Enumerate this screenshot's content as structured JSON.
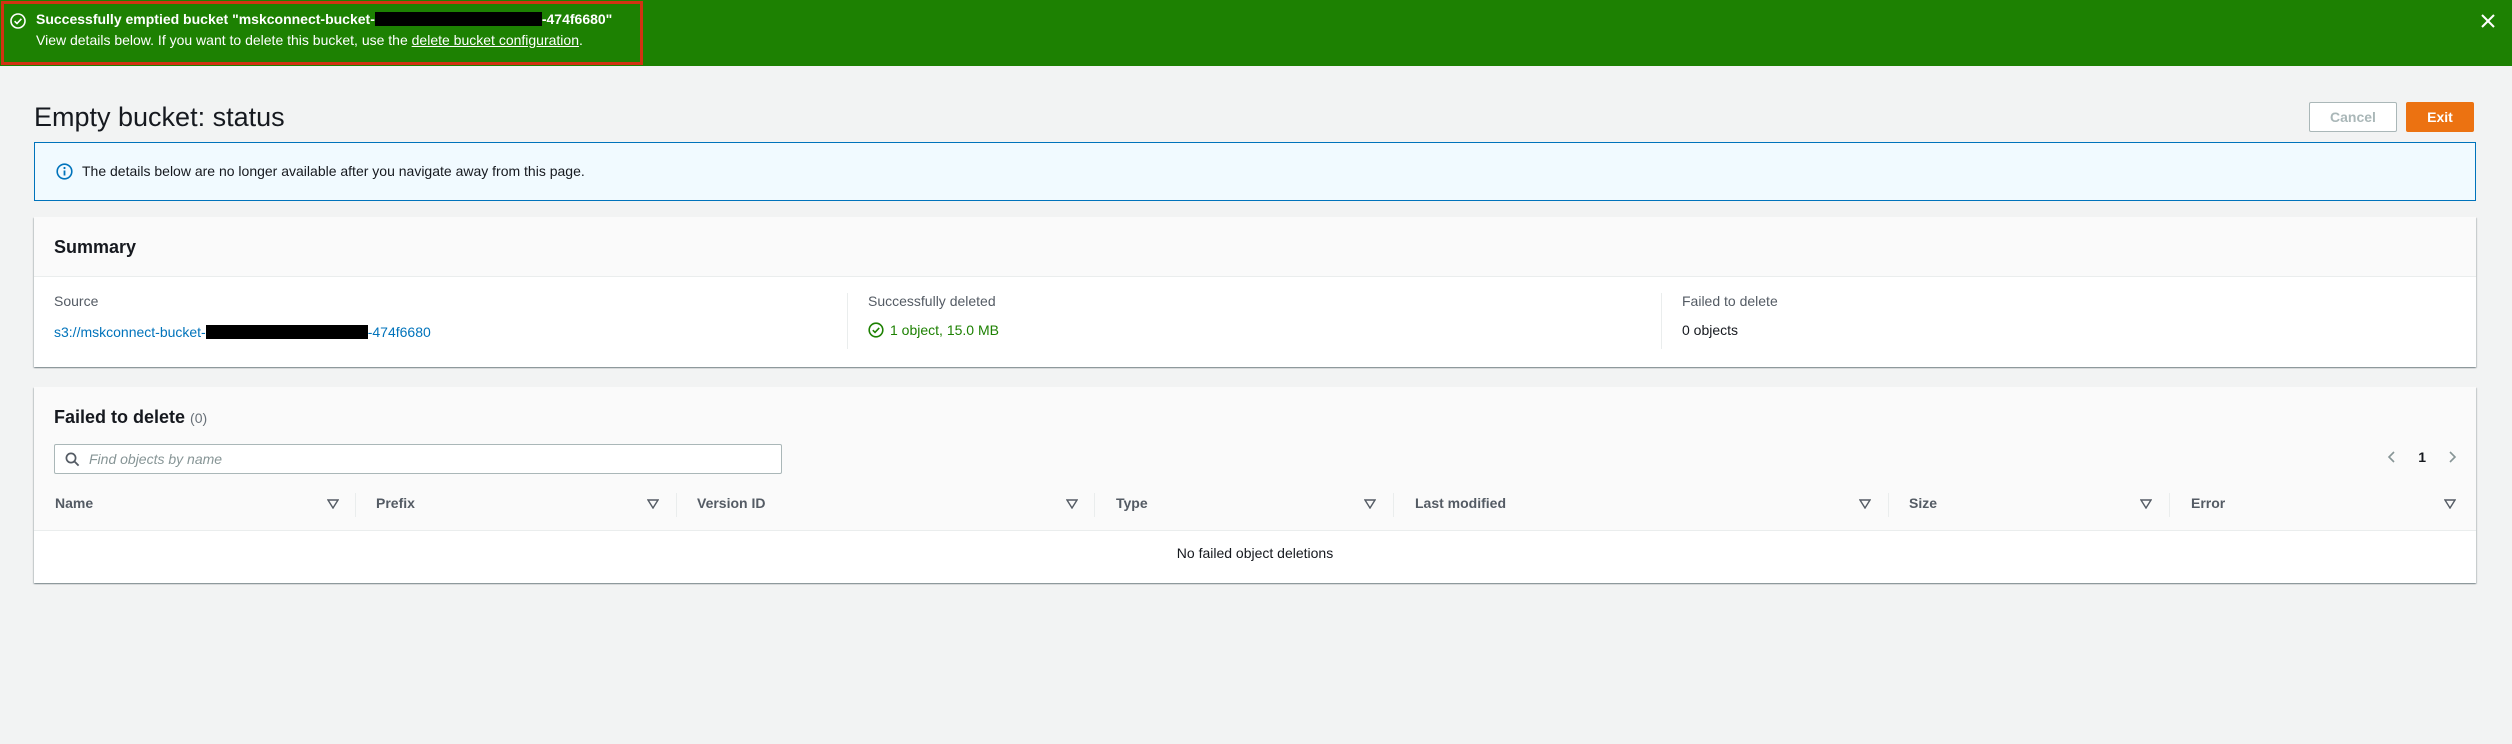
{
  "flash": {
    "title_prefix": "Successfully emptied bucket \"mskconnect-bucket-",
    "title_suffix": "-474f6680\"",
    "desc_prefix": "View details below. If you want to delete this bucket, use the ",
    "desc_link": "delete bucket configuration",
    "desc_suffix": ".",
    "icons": {
      "status": "check-circle-icon",
      "close": "close-icon"
    }
  },
  "header": {
    "title": "Empty bucket: status",
    "cancel_label": "Cancel",
    "exit_label": "Exit"
  },
  "info": {
    "text": "The details below are no longer available after you navigate away from this page."
  },
  "summary": {
    "title": "Summary",
    "source": {
      "label": "Source",
      "value_prefix": "s3://mskconnect-bucket-",
      "value_suffix": "-474f6680"
    },
    "deleted": {
      "label": "Successfully deleted",
      "value": "1 object, 15.0 MB"
    },
    "failed": {
      "label": "Failed to delete",
      "value": "0 objects"
    }
  },
  "failed_table": {
    "title": "Failed to delete",
    "count": "(0)",
    "search_placeholder": "Find objects by name",
    "page": "1",
    "columns": [
      "Name",
      "Prefix",
      "Version ID",
      "Type",
      "Last modified",
      "Size",
      "Error"
    ],
    "empty_message": "No failed object deletions"
  },
  "colors": {
    "flash_bg": "#1d8102",
    "highlight_border": "#d13212",
    "primary_button": "#ec7211",
    "link": "#0073bb",
    "info_border": "#0073bb"
  }
}
